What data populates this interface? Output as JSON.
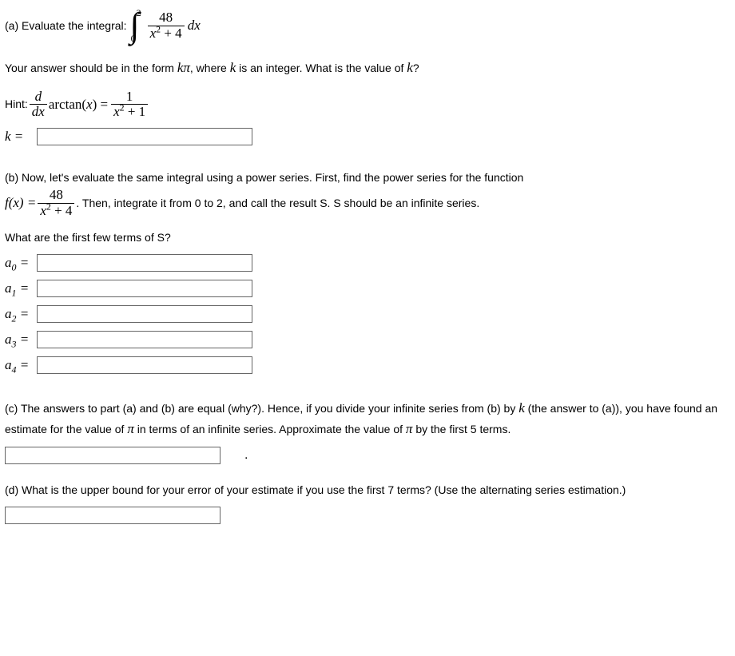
{
  "partA": {
    "prompt_prefix": "(a) Evaluate the integral: ",
    "int_upper": "2",
    "int_lower": "0",
    "integrand_num": "48",
    "integrand_den_x2": "x",
    "integrand_den_plus": " + 4",
    "integrand_dx": " dx",
    "instruction_pre": "Your answer should be in the form ",
    "instruction_kpi": "kπ",
    "instruction_mid": ", where ",
    "instruction_k": "k",
    "instruction_post": " is an integer. What is the value of ",
    "instruction_k2": "k",
    "instruction_q": "?",
    "hint_label": "Hint: ",
    "hint_d": "d",
    "hint_dx": "dx",
    "hint_arctan": "arctan(",
    "hint_arctan_x": "x",
    "hint_arctan_close": ") = ",
    "hint_rhs_num": "1",
    "hint_rhs_den_x": "x",
    "hint_rhs_den_plus": " + 1",
    "k_label": "k = "
  },
  "partB": {
    "line1": "(b) Now, let's evaluate the same integral using a power series. First, find the power series for the function",
    "fx_lhs": "f(x) = ",
    "fx_num": "48",
    "fx_den_x": "x",
    "fx_den_plus": " + 4",
    "line2": ". Then, integrate it from 0 to 2, and call the result S. S should be an infinite series.",
    "question": "What are the first few terms of S?",
    "a0": "a",
    "sub0": "0",
    "eq": " = ",
    "a1": "a",
    "sub1": "1",
    "a2": "a",
    "sub2": "2",
    "a3": "a",
    "sub3": "3",
    "a4": "a",
    "sub4": "4"
  },
  "partC": {
    "text_pre": "(c) The answers to part (a) and (b) are equal (why?). Hence, if you divide your infinite series from (b) by ",
    "k": "k",
    "text_mid": " (the answer to (a)), you have found an estimate for the value of ",
    "pi": "π",
    "text_mid2": " in terms of an infinite series. Approximate the value of ",
    "pi2": "π",
    "text_post": " by the first 5 terms.",
    "dot": "."
  },
  "partD": {
    "text": "(d) What is the upper bound for your error of your estimate if you use the first 7 terms? (Use the alternating series estimation.)"
  }
}
